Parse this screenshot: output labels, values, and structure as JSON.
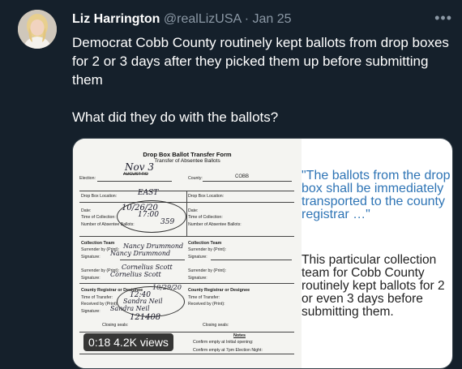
{
  "tweet": {
    "author_name": "Liz Harrington",
    "author_handle": "@realLizUSA",
    "separator": "·",
    "date": "Jan 25",
    "more_icon": "more-horizontal-icon",
    "text_line": "Democrat Cobb County routinely kept ballots from drop boxes for 2 or 3 days after they picked them up before submitting them",
    "text_question": "What did they do with the ballots?"
  },
  "media": {
    "document": {
      "title": "Drop Box Ballot Transfer Form",
      "subtitle": "Transfer of Absentee Ballots",
      "election_label": "Election:",
      "election_value_crossed": "AUGUST RO",
      "election_value_hand": "Nov 3",
      "county_label": "County:",
      "county_value": "COBB",
      "drop_box_location_label": "Drop Box Location:",
      "drop_box_location_value": "EAST",
      "date_label": "Date:",
      "date_value": "10/26/20",
      "time_of_collection_label": "Time of Collection:",
      "time_of_collection_value": "17:00",
      "number_ballots_label": "Number of Absentee Ballots:",
      "number_ballots_value": "359",
      "collection_team_label": "Collection Team",
      "surrender_by_label": "Surrender by (Print):",
      "surrender_by_value": "Nancy Drummond",
      "signature_label": "Signature:",
      "signature_value": "Nancy Drummond",
      "surrender_by2_value": "Cornelius Scott",
      "signature2_value": "Cornelius Scott",
      "county_registrar_label": "County Registrar or Designee",
      "registrar_date": "10/29/20",
      "time_of_transfer_label": "Time of Transfer:",
      "time_of_transfer_value": "12:40",
      "received_by_label": "Received by (Print):",
      "received_by_value": "Sandra Neil",
      "signature3_value": "Sandra Neil",
      "closing_seals_label": "Closing seals:",
      "closing_seals_value": "121408",
      "notes_label": "Notes",
      "confirm_opening_label": "Confirm empty at Initial opening:",
      "confirm_night_label": "Confirm empty at 7pm Election Night:",
      "right_drop_box_location": "Drop Box Location:",
      "right_date": "Date:",
      "right_time_collection": "Time of Collection:",
      "right_number_ballots": "Number of Absentee Ballots:",
      "right_collection_team": "Collection Team",
      "right_surrender_by": "Surrender by (Print):",
      "right_signature": "Signature:",
      "right_county_registrar": "County Registrar or Designee",
      "right_time_transfer": "Time of Transfer:",
      "right_received_by": "Received by (Print):",
      "right_closing_seals": "Closing seals:"
    },
    "quote": "\"The ballots from the drop box shall be immediately transported to the county registrar …\"",
    "note": "This particular collection team for Cobb County routinely kept ballots for 2 or even 3 days before submitting them.",
    "video_time": "0:18",
    "video_views": "4.2K views"
  }
}
